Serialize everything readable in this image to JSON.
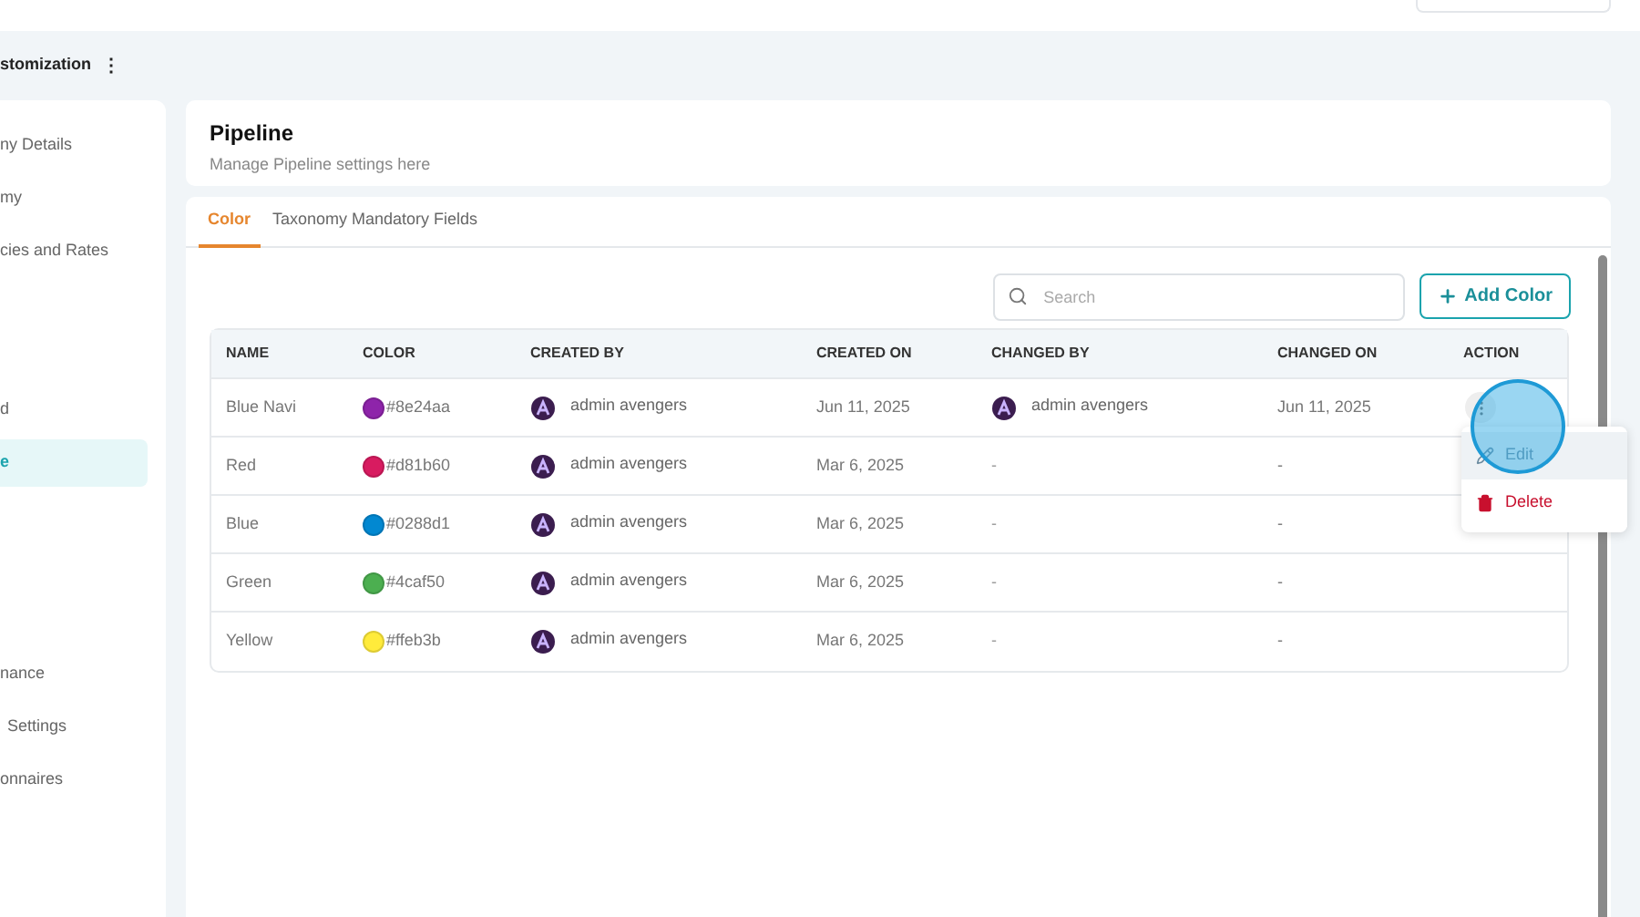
{
  "breadcrumb": {
    "title": "stomization",
    "menu_glyph": "⋮"
  },
  "sidebar": {
    "items": [
      {
        "label": "ny Details",
        "selected": false
      },
      {
        "label": "my",
        "selected": false
      },
      {
        "label": "cies and Rates",
        "selected": false
      },
      {
        "selected": false
      },
      {
        "selected": false
      },
      {
        "label": "d",
        "selected": false
      },
      {
        "label": "e",
        "selected": true
      },
      {
        "selected": false
      },
      {
        "selected": false
      },
      {
        "selected": false
      },
      {
        "label": "nance",
        "selected": false
      },
      {
        "label": "Settings",
        "selected": false
      },
      {
        "label": "onnaires",
        "selected": false
      }
    ]
  },
  "header": {
    "title": "Pipeline",
    "subtitle": "Manage Pipeline settings here"
  },
  "tabs": [
    {
      "label": "Color",
      "selected": true
    },
    {
      "label": "Taxonomy Mandatory Fields",
      "selected": false
    }
  ],
  "search": {
    "placeholder": "Search"
  },
  "add_button": {
    "label": "Add Color"
  },
  "table": {
    "columns": [
      "NAME",
      "COLOR",
      "CREATED BY",
      "CREATED ON",
      "CHANGED BY",
      "CHANGED ON",
      "ACTION"
    ],
    "rows": [
      {
        "name": "Blue Navi",
        "color": "#8e24aa",
        "hex": "#8e24aa",
        "created_by": "admin avengers",
        "created_on": "Jun 11, 2025",
        "changed_by": "admin avengers",
        "changed_on": "Jun 11, 2025",
        "menu_open": true
      },
      {
        "name": "Red",
        "color": "#d81b60",
        "hex": "#d81b60",
        "created_by": "admin avengers",
        "created_on": "Mar 6, 2025",
        "changed_by": "-",
        "changed_on": "-",
        "menu_open": false
      },
      {
        "name": "Blue",
        "color": "#0288d1",
        "hex": "#0288d1",
        "created_by": "admin avengers",
        "created_on": "Mar 6, 2025",
        "changed_by": "-",
        "changed_on": "-",
        "menu_open": false
      },
      {
        "name": "Green",
        "color": "#4caf50",
        "hex": "#4caf50",
        "created_by": "admin avengers",
        "created_on": "Mar 6, 2025",
        "changed_by": "-",
        "changed_on": "-",
        "menu_open": false
      },
      {
        "name": "Yellow",
        "color": "#ffeb3b",
        "hex": "#ffeb3b",
        "created_by": "admin avengers",
        "created_on": "Mar 6, 2025",
        "changed_by": "-",
        "changed_on": "-",
        "menu_open": false
      }
    ]
  },
  "action_menu": {
    "items": [
      {
        "kind": "edit",
        "label": "Edit",
        "selected": true
      },
      {
        "kind": "delete",
        "label": "Delete",
        "selected": false
      }
    ]
  }
}
